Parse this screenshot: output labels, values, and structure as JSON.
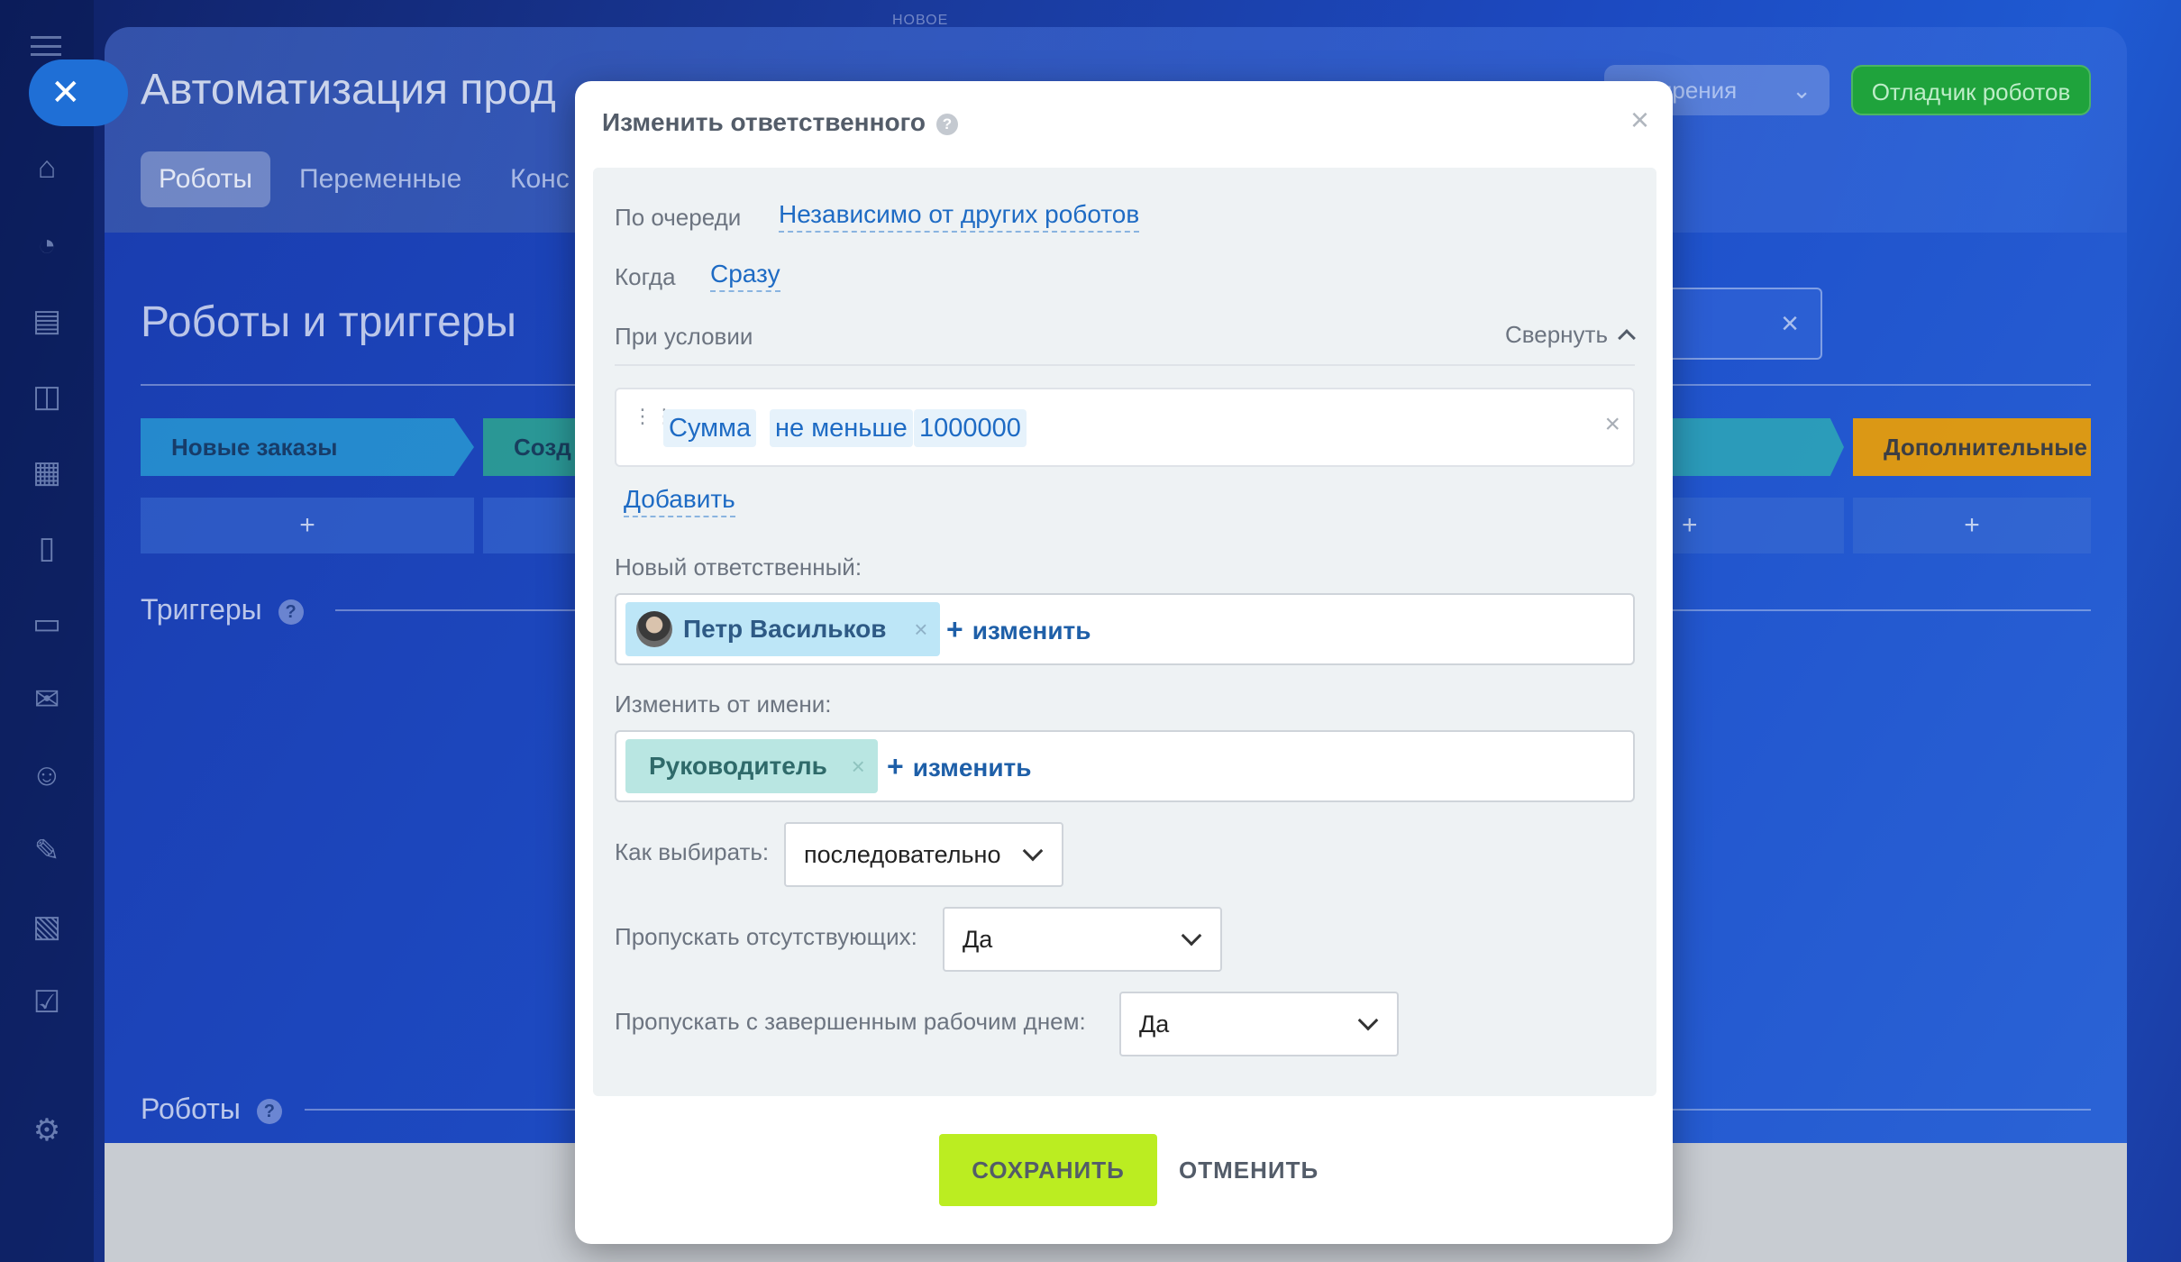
{
  "background": {
    "top_label": "НОВОЕ",
    "page_title": "Автоматизация прод",
    "tabs": [
      "Роботы",
      "Переменные",
      "Конс"
    ],
    "ext_button": "ширения",
    "debug_button": "Отладчик роботов",
    "section_title": "Роботы и триггеры",
    "stages": [
      {
        "label": "Новые заказы",
        "color": "#2aa3d6"
      },
      {
        "label": "Созд",
        "color": "#2fb38a"
      },
      {
        "label": "",
        "color": "#2fb3b3"
      },
      {
        "label": "Дополнительные",
        "color": "#f0a000"
      }
    ],
    "plus": "+",
    "triggers_title": "Триггеры",
    "robots_title": "Роботы",
    "qmark": "?"
  },
  "modal": {
    "title": "Изменить ответственного",
    "qmark": "?",
    "close": "×",
    "queue_label": "По очереди",
    "queue_value": "Независимо от других роботов",
    "when_label": "Когда",
    "when_value": "Сразу",
    "condition_label": "При условии",
    "collapse_label": "Свернуть",
    "condition": {
      "field": "Сумма",
      "operator": "не меньше",
      "value": "1000000"
    },
    "add_link": "Добавить",
    "new_responsible_label": "Новый ответственный:",
    "new_responsible_user": "Петр Васильков",
    "change_from_label": "Изменить от имени:",
    "change_from_role": "Руководитель",
    "change_link": "изменить",
    "plus": "+",
    "chip_remove": "×",
    "how_to_choose_label": "Как выбирать:",
    "how_to_choose_value": "последовательно",
    "skip_absent_label": "Пропускать отсутствующих:",
    "skip_absent_value": "Да",
    "skip_finished_label": "Пропускать с завершенным рабочим днем:",
    "skip_finished_value": "Да",
    "save_button": "СОХРАНИТЬ",
    "cancel_button": "ОТМЕНИТЬ"
  },
  "colors": {
    "save": "#bbed21",
    "link": "#1e6bc4",
    "debug": "#1fa33c"
  }
}
